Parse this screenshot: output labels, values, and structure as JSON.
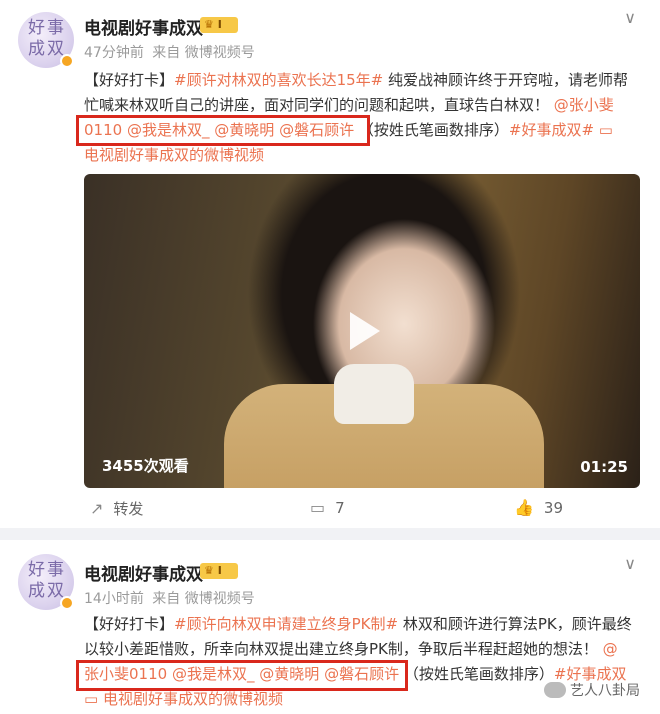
{
  "posts": [
    {
      "account_name": "电视剧好事成双",
      "avatar_text": "好事成双",
      "level_badge": "Ⅰ",
      "time": "47分钟前",
      "source": "来自 微博视频号",
      "text": {
        "prefix": "【好好打卡】",
        "topic": "#顾许对林双的喜欢长达15年#",
        "line_a": " 纯爱战神顾许终于开窍啦，请老师帮",
        "line_b": "忙喊来林双听自己的讲座，面对同学们的问题和起哄，直球告白林双！",
        "mention_zhang": "@张小斐",
        "mention_zhang_cont": "0110",
        "mention_linshuang": "@我是林双_",
        "mention_huang": "@黄晓明",
        "mention_panshi": "@磐石顾许",
        "note": "（按姓氏笔画数排序）",
        "topic_end": "#好事成双#",
        "video_link_icon": "▭",
        "video_link": "电视剧好事成双的微博视频"
      },
      "video": {
        "views": "3455次观看",
        "duration": "01:25"
      },
      "actions": {
        "repost_label": "转发",
        "comment_count": "7",
        "like_count": "39"
      }
    },
    {
      "account_name": "电视剧好事成双",
      "avatar_text": "好事成双",
      "level_badge": "Ⅰ",
      "time": "14小时前",
      "source": "来自 微博视频号",
      "text": {
        "prefix": "【好好打卡】",
        "topic": "#顾许向林双申请建立终身PK制#",
        "line_a": " 林双和顾许进行算法PK，顾许最终",
        "line_b": "以较小差距惜败，所幸向林双提出建立终身PK制，争取后半程赶超她的想法！",
        "mention_at": "@",
        "mention_zhang": "张小斐0110",
        "mention_linshuang": "@我是林双_",
        "mention_huang": "@黄晓明",
        "mention_panshi": "@磐石顾许",
        "note": "（按姓氏笔画数排序）",
        "topic_end": "#好事成双",
        "video_link_icon": "▭",
        "video_link": "电视剧好事成双的微博视频"
      }
    }
  ],
  "watermark": "艺人八卦局",
  "icons": {
    "chevron": "chevron-down-icon",
    "repost": "repost-icon",
    "comment": "comment-icon",
    "like": "like-icon",
    "play": "play-icon"
  },
  "colors": {
    "link": "#eb7350",
    "highlight_box": "#d9281c"
  }
}
